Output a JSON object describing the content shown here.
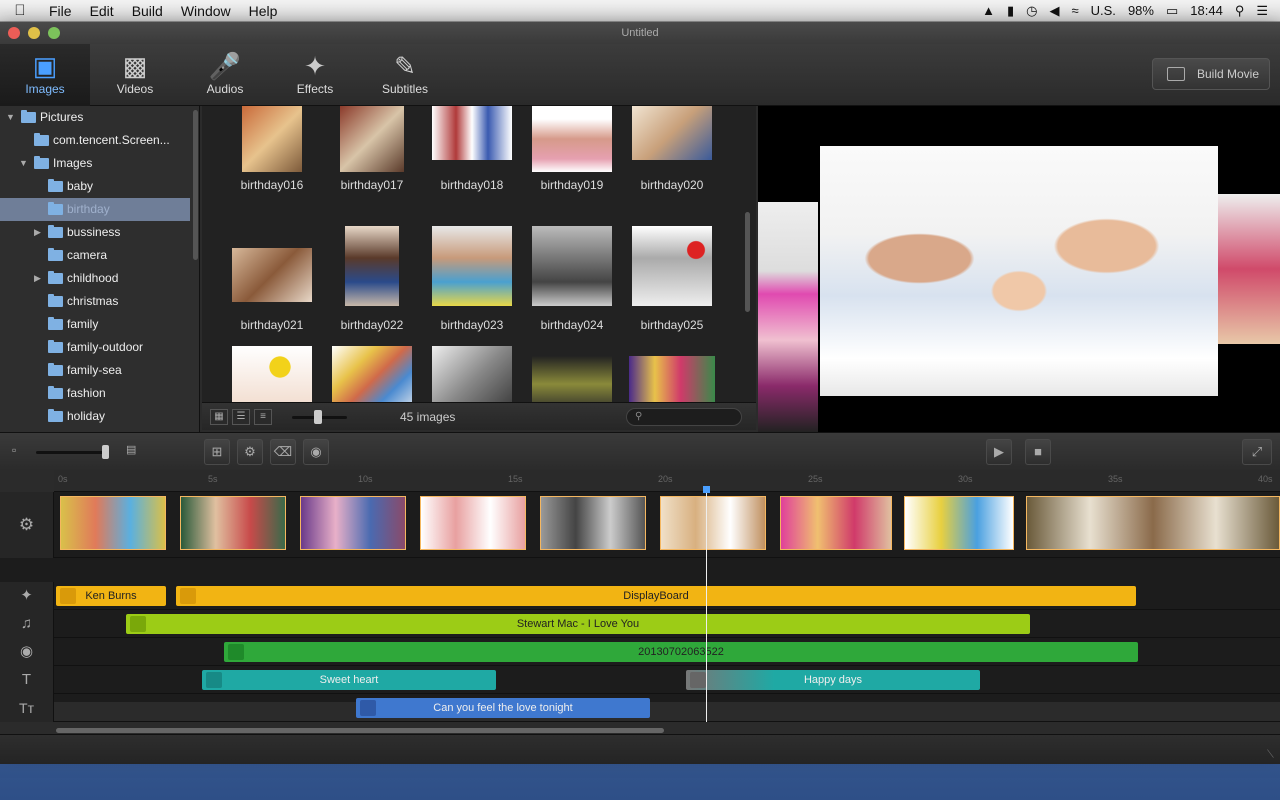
{
  "menubar": {
    "app_icon": "apple-icon",
    "items": [
      "File",
      "Edit",
      "Build",
      "Window",
      "Help"
    ],
    "status": {
      "input_source": "U.S.",
      "battery": "98%",
      "clock": "18:44"
    }
  },
  "window": {
    "title": "Untitled"
  },
  "toolbar": {
    "tabs": [
      {
        "label": "Images",
        "icon": "images-icon"
      },
      {
        "label": "Videos",
        "icon": "clapboard-icon"
      },
      {
        "label": "Audios",
        "icon": "microphone-icon"
      },
      {
        "label": "Effects",
        "icon": "magic-wand-icon"
      },
      {
        "label": "Subtitles",
        "icon": "pencil-icon"
      }
    ],
    "active_tab": "Images",
    "build_label": "Build Movie"
  },
  "sidebar": {
    "items": [
      {
        "label": "Pictures",
        "level": 0,
        "expanded": true
      },
      {
        "label": "com.tencent.Screen...",
        "level": 1
      },
      {
        "label": "Images",
        "level": 1,
        "expanded": true
      },
      {
        "label": "baby",
        "level": 2
      },
      {
        "label": "birthday",
        "level": 2,
        "selected": true
      },
      {
        "label": "bussiness",
        "level": 2,
        "collapsed": true
      },
      {
        "label": "camera",
        "level": 2
      },
      {
        "label": "childhood",
        "level": 2,
        "collapsed": true
      },
      {
        "label": "christmas",
        "level": 2
      },
      {
        "label": "family",
        "level": 2
      },
      {
        "label": "family-outdoor",
        "level": 2
      },
      {
        "label": "family-sea",
        "level": 2
      },
      {
        "label": "fashion",
        "level": 2
      },
      {
        "label": "holiday",
        "level": 2
      }
    ]
  },
  "grid": {
    "thumbnails": [
      "birthday016",
      "birthday017",
      "birthday018",
      "birthday019",
      "birthday020",
      "birthday021",
      "birthday022",
      "birthday023",
      "birthday024",
      "birthday025"
    ],
    "count_label": "45 images",
    "search_placeholder": ""
  },
  "timeline": {
    "ruler": [
      "0s",
      "5s",
      "10s",
      "15s",
      "20s",
      "25s",
      "30s",
      "35s",
      "40s"
    ],
    "tracks": {
      "effect_label": "Ken Burns",
      "effect2_label": "DisplayBoard",
      "music_label": "Stewart Mac - I Love You",
      "voice_label": "20130702063522",
      "subtitle1_label": "Sweet heart",
      "subtitle2_label": "Happy days",
      "caption_label": "Can you feel the love tonight"
    }
  },
  "colors": {
    "accent": "#4a9fff",
    "clip_orange": "#e8942a",
    "effect_yellow": "#f2b413",
    "music_green": "#9ccc16",
    "voice_green": "#2fa83a",
    "subtitle_teal": "#1fa9a4",
    "caption_blue": "#3f78cf"
  }
}
